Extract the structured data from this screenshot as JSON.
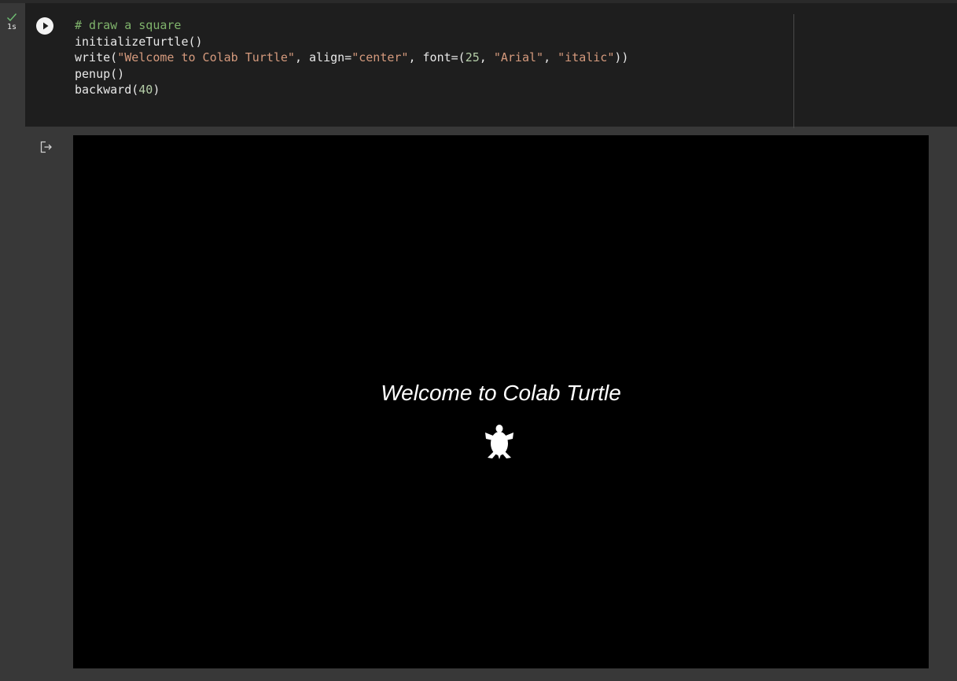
{
  "cell": {
    "status_icon": "check-icon",
    "exec_time": "1s",
    "run_icon": "play-icon",
    "code_lines": [
      [
        {
          "t": "comment",
          "v": "# draw a square"
        }
      ],
      [
        {
          "t": "plain",
          "v": "initializeTurtle()"
        }
      ],
      [
        {
          "t": "plain",
          "v": "write("
        },
        {
          "t": "string",
          "v": "\"Welcome to Colab Turtle\""
        },
        {
          "t": "plain",
          "v": ", align="
        },
        {
          "t": "string",
          "v": "\"center\""
        },
        {
          "t": "plain",
          "v": ", font=("
        },
        {
          "t": "number",
          "v": "25"
        },
        {
          "t": "plain",
          "v": ", "
        },
        {
          "t": "string",
          "v": "\"Arial\""
        },
        {
          "t": "plain",
          "v": ", "
        },
        {
          "t": "string",
          "v": "\"italic\""
        },
        {
          "t": "plain",
          "v": "))"
        }
      ],
      [
        {
          "t": "plain",
          "v": "penup()"
        }
      ],
      [
        {
          "t": "plain",
          "v": "backward("
        },
        {
          "t": "number",
          "v": "40"
        },
        {
          "t": "plain",
          "v": ")"
        }
      ]
    ]
  },
  "output": {
    "output_icon": "output-redirect-icon",
    "canvas_text": "Welcome to Colab Turtle",
    "turtle_icon": "turtle-icon"
  },
  "colors": {
    "background": "#383838",
    "code_background": "#1e1e1e",
    "canvas_background": "#000000",
    "comment": "#7fb36b",
    "string": "#d59a7d",
    "number": "#b5cea8",
    "status_ok": "#6fbf73"
  }
}
